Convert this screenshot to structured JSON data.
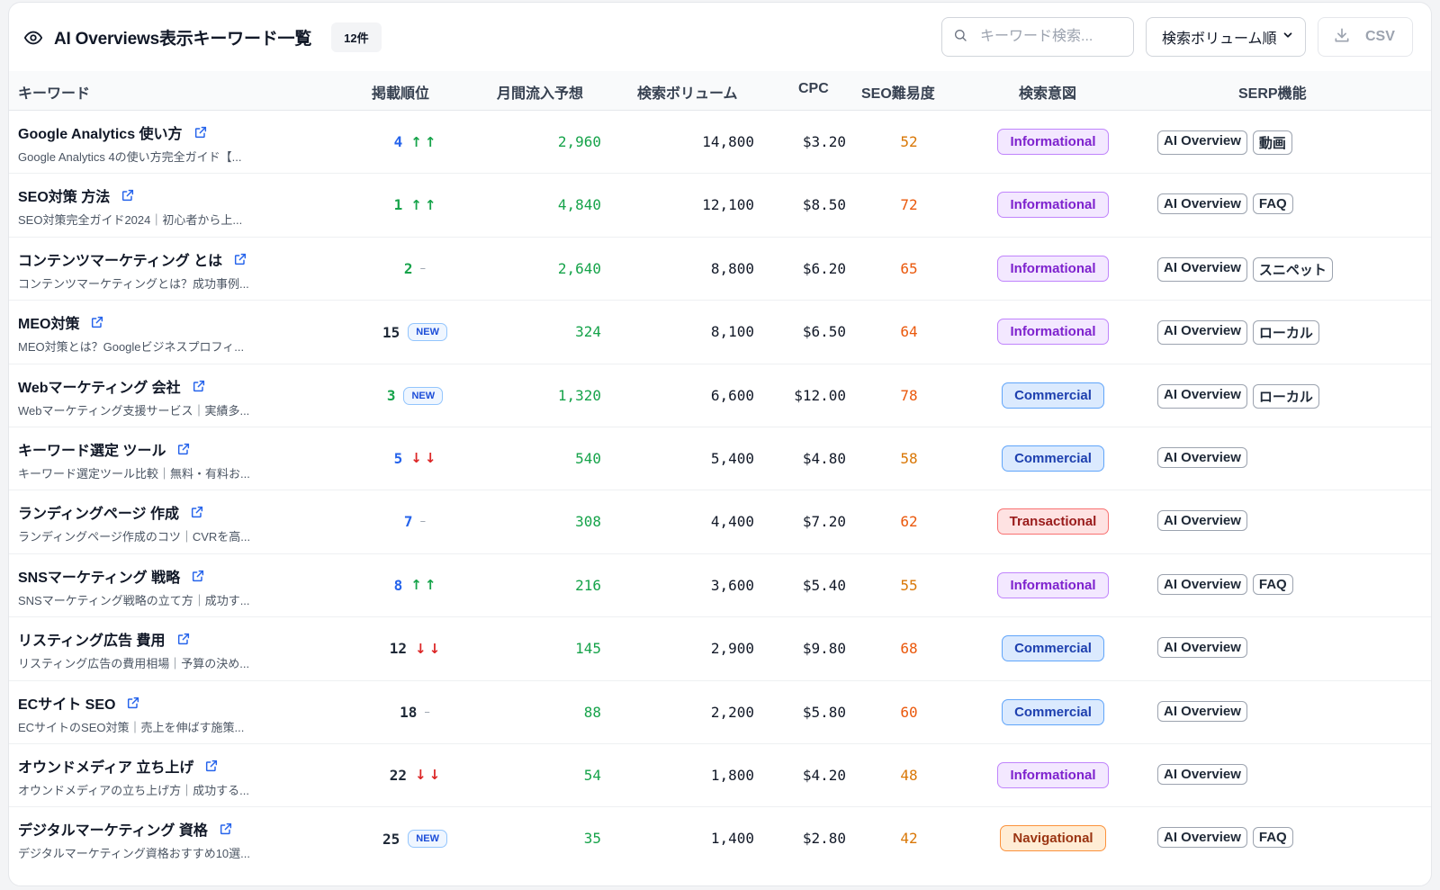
{
  "header": {
    "title": "AI Overviews表示キーワード一覧",
    "count_badge": "12件",
    "search_placeholder": "キーワード検索...",
    "sort_label": "検索ボリューム順",
    "csv_label": "CSV"
  },
  "columns": {
    "keyword": "キーワード",
    "rank": "掲載順位",
    "traffic": "月間流入予想",
    "volume": "検索ボリューム",
    "cpc": "CPC",
    "difficulty": "SEO難易度",
    "intent": "検索意図",
    "serp": "SERP機能"
  },
  "colors": {
    "rank_blue": "#2563eb",
    "rank_green": "#16a34a",
    "rank_dark": "#1f2937",
    "arrow_up": "#16a34a",
    "arrow_down": "#dc2626",
    "diff_orange": "#d97706",
    "diff_red": "#ea580c"
  },
  "rows": [
    {
      "keyword": "Google Analytics 使い方",
      "snippet": "Google Analytics 4の使い方完全ガイド【...",
      "rank": "4",
      "rank_color": "#2563eb",
      "trend": "up",
      "traffic": "2,960",
      "volume": "14,800",
      "cpc": "$3.20",
      "difficulty": "52",
      "difficulty_color": "#d97706",
      "intent": "Informational",
      "serp": [
        "AI Overview",
        "動画"
      ]
    },
    {
      "keyword": "SEO対策 方法",
      "snippet": "SEO対策完全ガイド2024｜初心者から上...",
      "rank": "1",
      "rank_color": "#16a34a",
      "trend": "up",
      "traffic": "4,840",
      "volume": "12,100",
      "cpc": "$8.50",
      "difficulty": "72",
      "difficulty_color": "#ea580c",
      "intent": "Informational",
      "serp": [
        "AI Overview",
        "FAQ"
      ]
    },
    {
      "keyword": "コンテンツマーケティング とは",
      "snippet": "コンテンツマーケティングとは？成功事例...",
      "rank": "2",
      "rank_color": "#16a34a",
      "trend": "flat",
      "traffic": "2,640",
      "volume": "8,800",
      "cpc": "$6.20",
      "difficulty": "65",
      "difficulty_color": "#ea580c",
      "intent": "Informational",
      "serp": [
        "AI Overview",
        "スニペット"
      ]
    },
    {
      "keyword": "MEO対策",
      "snippet": "MEO対策とは？Googleビジネスプロフィ...",
      "rank": "15",
      "rank_color": "#1f2937",
      "trend": "new",
      "traffic": "324",
      "volume": "8,100",
      "cpc": "$6.50",
      "difficulty": "64",
      "difficulty_color": "#ea580c",
      "intent": "Informational",
      "serp": [
        "AI Overview",
        "ローカル"
      ]
    },
    {
      "keyword": "Webマーケティング 会社",
      "snippet": "Webマーケティング支援サービス｜実績多...",
      "rank": "3",
      "rank_color": "#16a34a",
      "trend": "new",
      "traffic": "1,320",
      "volume": "6,600",
      "cpc": "$12.00",
      "difficulty": "78",
      "difficulty_color": "#ea580c",
      "intent": "Commercial",
      "serp": [
        "AI Overview",
        "ローカル"
      ]
    },
    {
      "keyword": "キーワード選定 ツール",
      "snippet": "キーワード選定ツール比較｜無料・有料お...",
      "rank": "5",
      "rank_color": "#2563eb",
      "trend": "down",
      "traffic": "540",
      "volume": "5,400",
      "cpc": "$4.80",
      "difficulty": "58",
      "difficulty_color": "#d97706",
      "intent": "Commercial",
      "serp": [
        "AI Overview"
      ]
    },
    {
      "keyword": "ランディングページ 作成",
      "snippet": "ランディングページ作成のコツ｜CVRを高...",
      "rank": "7",
      "rank_color": "#2563eb",
      "trend": "flat",
      "traffic": "308",
      "volume": "4,400",
      "cpc": "$7.20",
      "difficulty": "62",
      "difficulty_color": "#ea580c",
      "intent": "Transactional",
      "serp": [
        "AI Overview"
      ]
    },
    {
      "keyword": "SNSマーケティング 戦略",
      "snippet": "SNSマーケティング戦略の立て方｜成功す...",
      "rank": "8",
      "rank_color": "#2563eb",
      "trend": "up",
      "traffic": "216",
      "volume": "3,600",
      "cpc": "$5.40",
      "difficulty": "55",
      "difficulty_color": "#d97706",
      "intent": "Informational",
      "serp": [
        "AI Overview",
        "FAQ"
      ]
    },
    {
      "keyword": "リスティング広告 費用",
      "snippet": "リスティング広告の費用相場｜予算の決め...",
      "rank": "12",
      "rank_color": "#1f2937",
      "trend": "down",
      "traffic": "145",
      "volume": "2,900",
      "cpc": "$9.80",
      "difficulty": "68",
      "difficulty_color": "#ea580c",
      "intent": "Commercial",
      "serp": [
        "AI Overview"
      ]
    },
    {
      "keyword": "ECサイト SEO",
      "snippet": "ECサイトのSEO対策｜売上を伸ばす施策...",
      "rank": "18",
      "rank_color": "#1f2937",
      "trend": "flat",
      "traffic": "88",
      "volume": "2,200",
      "cpc": "$5.80",
      "difficulty": "60",
      "difficulty_color": "#ea580c",
      "intent": "Commercial",
      "serp": [
        "AI Overview"
      ]
    },
    {
      "keyword": "オウンドメディア 立ち上げ",
      "snippet": "オウンドメディアの立ち上げ方｜成功する...",
      "rank": "22",
      "rank_color": "#1f2937",
      "trend": "down",
      "traffic": "54",
      "volume": "1,800",
      "cpc": "$4.20",
      "difficulty": "48",
      "difficulty_color": "#d97706",
      "intent": "Informational",
      "serp": [
        "AI Overview"
      ]
    },
    {
      "keyword": "デジタルマーケティング 資格",
      "snippet": "デジタルマーケティング資格おすすめ10選...",
      "rank": "25",
      "rank_color": "#1f2937",
      "trend": "new",
      "traffic": "35",
      "volume": "1,400",
      "cpc": "$2.80",
      "difficulty": "42",
      "difficulty_color": "#d97706",
      "intent": "Navigational",
      "serp": [
        "AI Overview",
        "FAQ"
      ]
    }
  ],
  "labels": {
    "new": "NEW",
    "flat": "–",
    "up": "↑",
    "down": "↓"
  },
  "intent_styles": {
    "Informational": {
      "bg": "#f3e8ff",
      "border": "#c084fc",
      "color": "#7e22ce"
    },
    "Commercial": {
      "bg": "#dbeafe",
      "border": "#60a5fa",
      "color": "#1e40af"
    },
    "Transactional": {
      "bg": "#fee2e2",
      "border": "#f87171",
      "color": "#991b1b"
    },
    "Navigational": {
      "bg": "#ffedd5",
      "border": "#fb923c",
      "color": "#9a3412"
    }
  }
}
